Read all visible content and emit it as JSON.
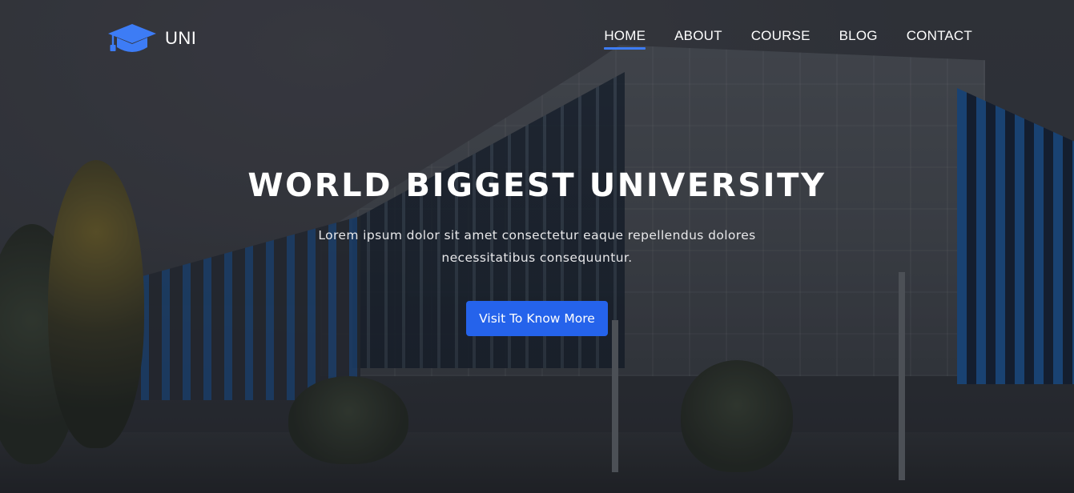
{
  "header": {
    "brand": {
      "icon": "graduation-cap-icon",
      "name": "UNI"
    },
    "nav": [
      {
        "label": "HOME",
        "active": true
      },
      {
        "label": "ABOUT",
        "active": false
      },
      {
        "label": "COURSE",
        "active": false
      },
      {
        "label": "BLOG",
        "active": false
      },
      {
        "label": "CONTACT",
        "active": false
      }
    ]
  },
  "hero": {
    "title": "WORLD BIGGEST UNIVERSITY",
    "text": "Lorem ipsum dolor sit amet consectetur eaque repellendus dolores necessitatibus consequuntur.",
    "cta_label": "Visit To Know More",
    "background_image": "university building at dusk"
  },
  "colors": {
    "accent": "#3d7cf5",
    "button": "#2563eb",
    "text": "#ffffff"
  }
}
